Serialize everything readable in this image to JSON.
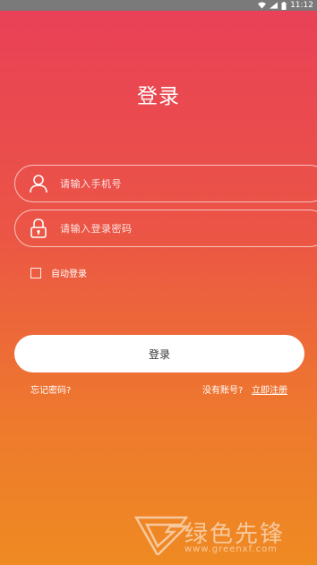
{
  "status_bar": {
    "time": "11:12"
  },
  "page": {
    "title": "登录"
  },
  "form": {
    "phone_placeholder": "请输入手机号",
    "password_placeholder": "请输入登录密码",
    "auto_login_label": "自动登录",
    "submit_label": "登录"
  },
  "links": {
    "forgot_password": "忘记密码?",
    "no_account": "没有账号?",
    "register": "立即注册"
  },
  "watermark": {
    "text": "绿色先锋",
    "url": "www.greenxf.com"
  },
  "colors": {
    "gradient_top": "#e94058",
    "gradient_bottom": "#ef8a22",
    "button_bg": "#ffffff"
  }
}
